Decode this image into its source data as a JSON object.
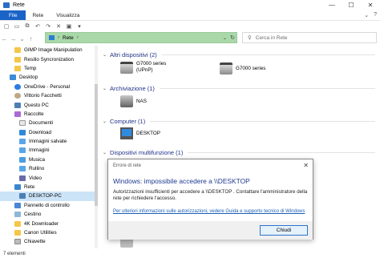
{
  "window": {
    "title": "Rete",
    "minimize": "—",
    "maximize": "☐",
    "close": "✕"
  },
  "ribbon": {
    "tabs": [
      "File",
      "Rete",
      "Visualizza"
    ],
    "collapse": "⌄",
    "help": "?"
  },
  "nav": {
    "back": "←",
    "forward": "→",
    "recent": "⌄",
    "up": "↑",
    "address": {
      "root": "Rete",
      "separator": "›",
      "dropdown": "⌄",
      "refresh": "↻"
    },
    "search_placeholder": "Cerca in Rete"
  },
  "tree": [
    {
      "label": "GIMP Image Manipulation",
      "icon": "folder-icon"
    },
    {
      "label": "Resilio Syncronization",
      "icon": "folder-icon"
    },
    {
      "label": "Temp",
      "icon": "folder-icon"
    },
    {
      "label": "Desktop",
      "icon": "desktop-icon"
    },
    {
      "label": "OneDrive - Personal",
      "icon": "onedrive-icon"
    },
    {
      "label": "Vittorio Facchetti",
      "icon": "user-icon"
    },
    {
      "label": "Questo PC",
      "icon": "pc-icon"
    },
    {
      "label": "Raccolte",
      "icon": "library-icon"
    },
    {
      "label": "Documenti",
      "icon": "documents-icon"
    },
    {
      "label": "Download",
      "icon": "download-icon"
    },
    {
      "label": "Immagini salvate",
      "icon": "pictures-icon"
    },
    {
      "label": "Immagini",
      "icon": "pictures-icon"
    },
    {
      "label": "Musica",
      "icon": "music-icon"
    },
    {
      "label": "Rullino",
      "icon": "pictures-icon"
    },
    {
      "label": "Video",
      "icon": "video-icon"
    },
    {
      "label": "Rete",
      "icon": "network-icon"
    },
    {
      "label": "DESKTOP-PC",
      "icon": "computer-icon"
    },
    {
      "label": "Pannello di controllo",
      "icon": "control-panel-icon"
    },
    {
      "label": "Cestino",
      "icon": "recycle-bin-icon"
    },
    {
      "label": "4K Downloader",
      "icon": "folder-icon"
    },
    {
      "label": "Canon Utilities",
      "icon": "folder-icon"
    },
    {
      "label": "Chiavette",
      "icon": "usb-drive-icon"
    }
  ],
  "groups": {
    "altri": "Altri dispositivi (2)",
    "archiviazione": "Archiviazione (1)",
    "computer": "Computer (1)",
    "multifunzione": "Dispositivi multifunzione (1)",
    "chevron": "⌄"
  },
  "devices": {
    "g7000_upnp": {
      "line1": "G7000 series",
      "line2": "(UPnP)"
    },
    "g7000": {
      "label": "G7000 series"
    },
    "nas": {
      "label": "NAS"
    },
    "desktop": {
      "label": "DESKTOP"
    }
  },
  "status": {
    "items": "7 elementi"
  },
  "dialog": {
    "title": "Errore di rete",
    "close": "✕",
    "heading": "Windows: impossibile accedere a \\\\DESKTOP",
    "message": "Autorizzazioni insufficienti per accedere a \\\\DESKTOP . Contattare l'amministratore della rete per richiedere l'accesso.",
    "link": "Per ulteriori informazioni sulle autorizzazioni, vedere Guida e supporto tecnico di Windows",
    "button": "Chiudi"
  }
}
